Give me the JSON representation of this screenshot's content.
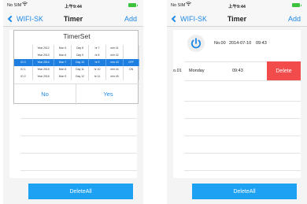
{
  "left_screen": {
    "status_bar": {
      "carrier": "No SIM",
      "time": "上午9:44",
      "battery_color": "#3cc23c"
    },
    "nav": {
      "back_label": "WIFI-SK",
      "title": "Timer",
      "add_label": "Add"
    },
    "dialog": {
      "title": "TimerSet",
      "picker_rows": [
        [
          "",
          "Year 2012",
          "Mon 5",
          "Day 8",
          "hr 7",
          "min 41",
          ""
        ],
        [
          "",
          "Year 2013",
          "Mon 6",
          "Day 9",
          "hr 8",
          "min 42",
          ""
        ],
        [
          "ID 0",
          "Year 2014",
          "Mon 7",
          "Day 10",
          "hr 9",
          "min 43",
          "OFF"
        ],
        [
          "ID 1",
          "Year 2015",
          "Mon 8",
          "Day 11",
          "hr 10",
          "min 44",
          "ON"
        ],
        [
          "ID 2",
          "Year 2016",
          "Mon 9",
          "Day 12",
          "hr 11",
          "min 45",
          ""
        ]
      ],
      "selected_row": 2,
      "no_label": "No",
      "yes_label": "Yes"
    },
    "delete_all_label": "DeleteAll"
  },
  "right_screen": {
    "status_bar": {
      "carrier": "No SIM",
      "time": "上午9:44",
      "battery_color": "#3cc23c"
    },
    "nav": {
      "back_label": "WIFI-SK",
      "title": "Timer",
      "add_label": "Add"
    },
    "timers": [
      {
        "id": "No.00",
        "date": "2014-07-10",
        "time": "09:43",
        "icon": "power-icon"
      },
      {
        "id": "o.01",
        "day": "Monday",
        "time": "09:43",
        "action": "Delete"
      }
    ],
    "delete_all_label": "DeleteAll"
  },
  "colors": {
    "accent": "#1e88e5",
    "button": "#1da1f2",
    "delete": "#f24b4b",
    "picker_selected": "#1e7fe0"
  }
}
